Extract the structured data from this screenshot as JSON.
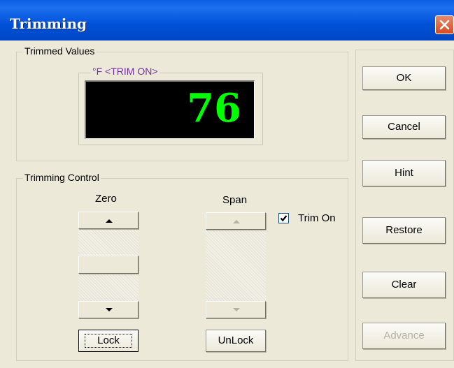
{
  "window": {
    "title": "Trimming"
  },
  "trimmed_values": {
    "legend": "Trimmed Values",
    "unit_label": "°F <TRIM ON>",
    "value": "76",
    "value_color": "#00ff00"
  },
  "trimming_control": {
    "legend": "Trimming Control",
    "zero": {
      "label": "Zero",
      "lock_label": "Lock"
    },
    "span": {
      "label": "Span",
      "unlock_label": "UnLock"
    },
    "trim_on": {
      "label": "Trim On",
      "checked": true
    }
  },
  "buttons": {
    "ok": "OK",
    "cancel": "Cancel",
    "hint": "Hint",
    "restore": "Restore",
    "clear": "Clear",
    "advance": "Advance"
  },
  "icons": {
    "close": "close-icon",
    "up": "arrow-up-icon",
    "down": "arrow-down-icon",
    "check": "checkmark-icon"
  }
}
